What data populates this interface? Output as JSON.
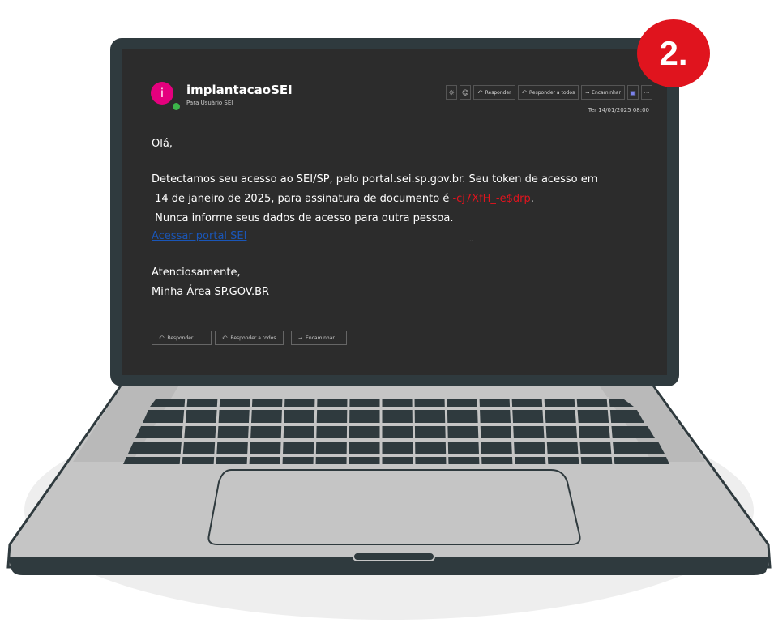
{
  "badge": "2.",
  "email": {
    "avatar_letter": "i",
    "sender": "implantacaoSEI",
    "to": "Para  Usuário SEI",
    "date": "Ter 14/01/2025 08:00",
    "toolbar": {
      "brightness_icon": "sun-icon",
      "emoji_icon": "smiley-icon",
      "reply": "Responder",
      "reply_all": "Responder a todos",
      "forward": "Encaminhar",
      "teams_icon": "teams-icon",
      "more": "···"
    },
    "greeting": "Olá,",
    "line1": "Detectamos seu acesso ao SEI/SP, pelo portal.sei.sp.gov.br. Seu token de acesso em",
    "line2_prefix": " 14 de janeiro de 2025, para assinatura de documento é ",
    "token": "-cj7XfH_-e$drp",
    "line2_suffix": ".",
    "line3": " Nunca informe seus dados de acesso para outra pessoa.",
    "link": "Acessar portal SEI",
    "sign1": "Atenciosamente,",
    "sign2": "Minha Área SP.GOV.BR",
    "bottom_buttons": {
      "reply": "Responder",
      "reply_all": "Responder a todos",
      "forward": "Encaminhar"
    }
  },
  "colors": {
    "accent_red": "#e0141e",
    "avatar_pink": "#e5007e",
    "link_blue": "#1a56b8",
    "screen_bg": "#2c2c2c"
  }
}
